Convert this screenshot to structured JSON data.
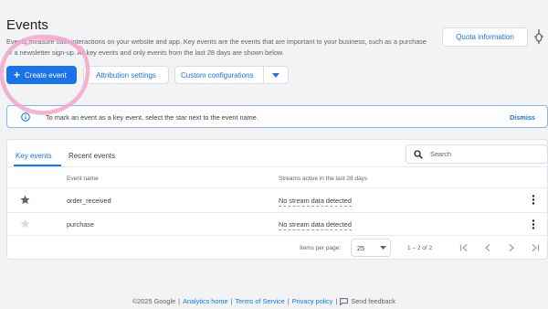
{
  "header": {
    "title": "Events",
    "description": "Events measure user interactions on your website and app. Key events are the events that are important to your business, such as a purchase or a newsletter sign-up. All key events and only events from the last 28 days are shown below.",
    "quota_label": "Quota information",
    "debug_icon": "debug-bug-icon"
  },
  "toolbar": {
    "create_label": "Create event",
    "attribution_label": "Attribution settings",
    "custom_label": "Custom configurations"
  },
  "banner": {
    "text": "To mark an event as a key event, select the star next to the event name.",
    "dismiss_label": "Dismiss"
  },
  "tabs": [
    {
      "label": "Key events",
      "active": true
    },
    {
      "label": "Recent events",
      "active": false
    }
  ],
  "search": {
    "placeholder": "Search"
  },
  "table": {
    "columns": [
      "Event name",
      "Streams active in the last 28 days"
    ],
    "rows": [
      {
        "name": "order_received",
        "streams": "No stream data detected",
        "starred": true
      },
      {
        "name": "purchase",
        "streams": "No stream data detected",
        "starred": false
      }
    ]
  },
  "pagination": {
    "items_per_page_label": "Items per page:",
    "items_per_page": "25",
    "range": "1 – 2 of 2"
  },
  "footer": {
    "copyright": "©2025 Google",
    "links": [
      "Analytics home",
      "Terms of Service",
      "Privacy policy"
    ],
    "feedback": "Send feedback"
  },
  "colors": {
    "accent": "#1a73e8",
    "annotation": "#f3a6cc"
  }
}
